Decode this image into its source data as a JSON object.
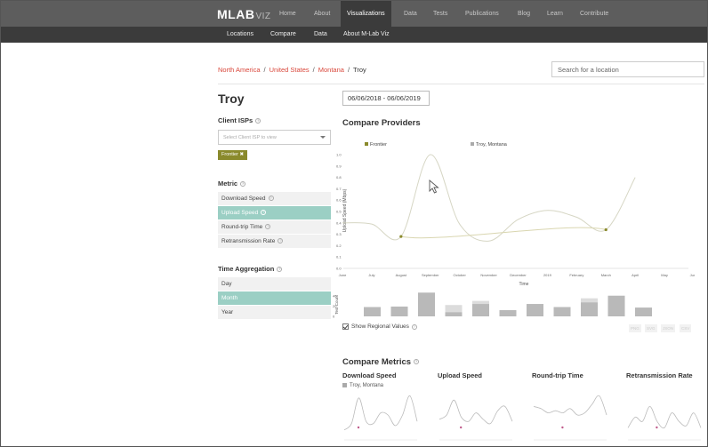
{
  "nav": {
    "logo": "MLAB",
    "logo_suffix": "VIZ",
    "items": [
      "Home",
      "About",
      "Visualizations",
      "Data",
      "Tests",
      "Publications",
      "Blog",
      "Learn",
      "Contribute"
    ],
    "active": "Visualizations",
    "subitems": [
      "Locations",
      "Compare",
      "Data",
      "About M-Lab Viz"
    ]
  },
  "breadcrumb": [
    "North America",
    "United States",
    "Montana",
    "Troy"
  ],
  "search": {
    "placeholder": "Search for a location"
  },
  "city": "Troy",
  "date_range": "06/06/2018 - 06/06/2019",
  "client_isps": {
    "label": "Client ISPs",
    "select_placeholder": "Select Client ISP to view",
    "selected_tag": "Frontier"
  },
  "metric": {
    "label": "Metric",
    "options": [
      "Download Speed",
      "Upload Speed",
      "Round-trip Time",
      "Retransmission Rate"
    ],
    "selected": "Upload Speed"
  },
  "time_aggregation": {
    "label": "Time Aggregation",
    "options": [
      "Day",
      "Month",
      "Year"
    ],
    "selected": "Month"
  },
  "compare_providers": {
    "title": "Compare Providers"
  },
  "show_regional": "Show Regional Values",
  "downloads": [
    "PNG",
    "SVG",
    "JSON",
    "CSV"
  ],
  "compare_metrics": {
    "title": "Compare Metrics",
    "columns": [
      "Download Speed",
      "Upload Speed",
      "Round-trip Time",
      "Retransmission Rate"
    ],
    "legend": "Troy, Montana"
  },
  "colors": {
    "frontier": "#8a8a2c",
    "troy": "#aaaaaa",
    "accent": "#d9473b",
    "selected": "#9bcfc4"
  },
  "chart_data": [
    {
      "type": "line",
      "title": "",
      "xlabel": "Time",
      "ylabel": "Upload Speed (Mbps)",
      "ylim": [
        0,
        1.0
      ],
      "yticks": [
        "0.0",
        "0.1",
        "0.2",
        "0.3",
        "0.4",
        "0.5",
        "0.6",
        "0.7",
        "0.8",
        "0.9",
        "1.0"
      ],
      "xticks": [
        "June",
        "July",
        "August",
        "September",
        "October",
        "November",
        "December",
        "2019",
        "February",
        "March",
        "April",
        "May",
        "June"
      ],
      "legend": [
        "Frontier",
        "Troy, Montana"
      ],
      "series": [
        {
          "name": "Frontier",
          "points": [
            [
              2,
              0.28
            ],
            [
              9,
              0.34
            ]
          ]
        },
        {
          "name": "Troy, Montana",
          "points": [
            [
              0,
              0.4
            ],
            [
              1,
              0.39
            ],
            [
              2,
              0.28
            ],
            [
              3,
              1.0
            ],
            [
              4,
              0.39
            ],
            [
              5,
              0.24
            ],
            [
              6,
              0.43
            ],
            [
              7,
              0.51
            ],
            [
              8,
              0.45
            ],
            [
              9,
              0.34
            ],
            [
              10,
              0.8
            ]
          ]
        }
      ]
    },
    {
      "type": "bar",
      "xlabel": "",
      "ylabel": "Test Count",
      "ylim": [
        0,
        50
      ],
      "yticks": [
        "0",
        "20",
        "40"
      ],
      "categories": [
        "July",
        "August",
        "September",
        "October",
        "November",
        "December",
        "2019",
        "February",
        "March",
        "April",
        "May"
      ],
      "series": [
        {
          "name": "Troy, Montana",
          "values": [
            18,
            19,
            46,
            22,
            30,
            12,
            24,
            18,
            35,
            40,
            17
          ]
        },
        {
          "name": "Frontier",
          "values": [
            18,
            19,
            46,
            8,
            24,
            12,
            24,
            18,
            27,
            40,
            17
          ]
        }
      ]
    },
    {
      "type": "line",
      "title": "Download Speed",
      "x": [
        0,
        1,
        2,
        3,
        4,
        5,
        6,
        7,
        8,
        9,
        10
      ],
      "values": [
        0.15,
        0.3,
        0.9,
        0.35,
        0.3,
        0.55,
        0.5,
        0.25,
        0.5,
        0.95,
        0.35
      ],
      "marker_index": 0
    },
    {
      "type": "line",
      "title": "Upload Speed",
      "x": [
        0,
        1,
        2,
        3,
        4,
        5,
        6,
        7,
        8,
        9,
        10
      ],
      "values": [
        0.4,
        0.5,
        0.85,
        0.45,
        0.35,
        0.55,
        0.4,
        0.3,
        0.6,
        0.7,
        0.35
      ],
      "marker_index": 1
    },
    {
      "type": "line",
      "title": "Round-trip Time",
      "x": [
        0,
        1,
        2,
        3,
        4,
        5,
        6,
        7,
        8,
        9,
        10
      ],
      "values": [
        0.7,
        0.65,
        0.55,
        0.6,
        0.55,
        0.65,
        0.5,
        0.55,
        0.75,
        0.95,
        0.5
      ],
      "marker_index": 2
    },
    {
      "type": "line",
      "title": "Retransmission Rate",
      "x": [
        0,
        1,
        2,
        3,
        4,
        5,
        6,
        7,
        8,
        9,
        10
      ],
      "values": [
        0.2,
        0.45,
        0.35,
        0.7,
        0.35,
        0.2,
        0.55,
        0.35,
        0.25,
        0.55,
        0.2
      ],
      "marker_index": 2
    }
  ]
}
